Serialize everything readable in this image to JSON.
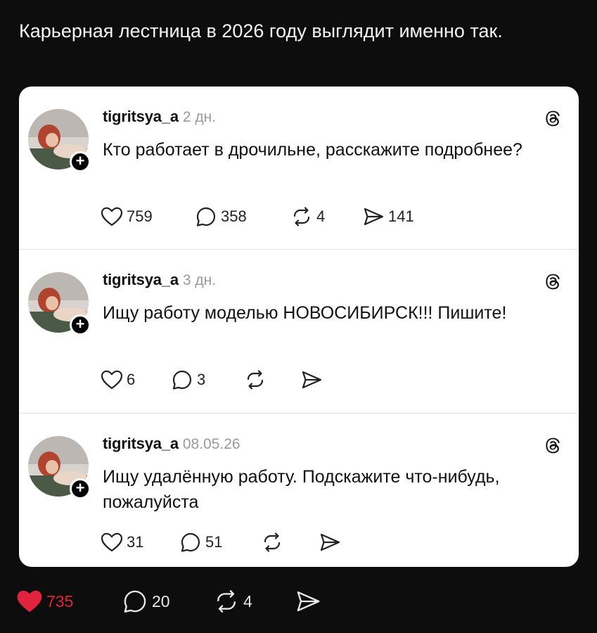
{
  "caption": "Карьерная лестница в 2026 году выглядит именно так.",
  "posts": [
    {
      "username": "tigritsya_a",
      "time": "2 дн.",
      "text": "Кто работает в дрочильне, расскажите подробнее?",
      "likes": "759",
      "comments": "358",
      "reposts": "4",
      "shares": "141"
    },
    {
      "username": "tigritsya_a",
      "time": "3 дн.",
      "text": "Ищу работу моделью НОВОСИБИРСК!!! Пишите!",
      "likes": "6",
      "comments": "3",
      "reposts": "",
      "shares": ""
    },
    {
      "username": "tigritsya_a",
      "time": "08.05.26",
      "text": "Ищу удалённую работу. Подскажите что-нибудь, пожалуйста",
      "likes": "31",
      "comments": "51",
      "reposts": "",
      "shares": ""
    }
  ],
  "footer": {
    "likes": "735",
    "comments": "20",
    "reposts": "4",
    "like_color": "#e0243d"
  },
  "icons": {
    "like": "heart-icon",
    "comment": "comment-bubble-icon",
    "repost": "repost-icon",
    "share": "send-icon",
    "platform": "threads-logo-icon",
    "follow": "plus-icon"
  }
}
